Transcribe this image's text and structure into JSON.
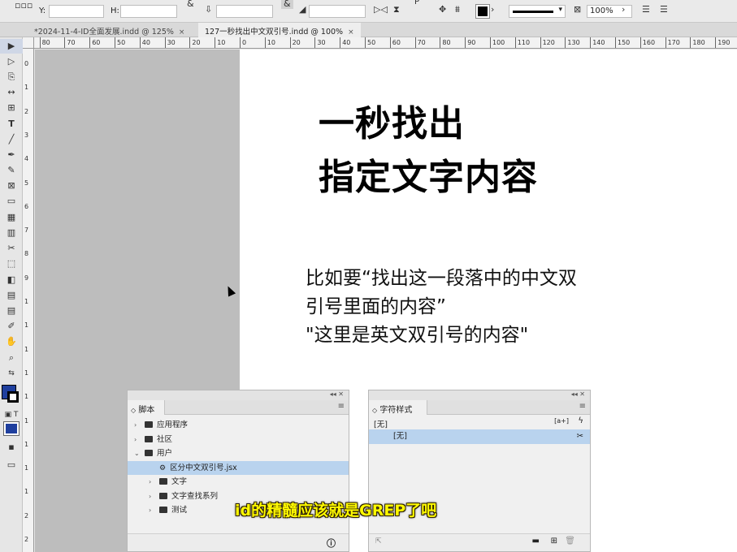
{
  "control_bar": {
    "y_label": "Y:",
    "h_label": "H:",
    "zoom_value": "100%",
    "p_label": "P"
  },
  "tabs": [
    {
      "label": "*2024-11-4-ID全面发展.indd @ 125%",
      "close": "×"
    },
    {
      "label": "127一秒找出中文双引号.indd @ 100%",
      "close": "×"
    }
  ],
  "ruler_top": {
    "labels": [
      "80",
      "70",
      "60",
      "50",
      "40",
      "30",
      "20",
      "10",
      "0",
      "10",
      "20",
      "30",
      "40",
      "50",
      "60",
      "70",
      "80",
      "90",
      "100",
      "110",
      "120",
      "130",
      "140",
      "150",
      "160",
      "170",
      "180",
      "190"
    ]
  },
  "ruler_left": {
    "labels": [
      "0",
      "1",
      "2",
      "3",
      "4",
      "5",
      "6",
      "7",
      "8",
      "9",
      "1",
      "1",
      "1",
      "1",
      "1",
      "1",
      "1",
      "1",
      "1",
      "2",
      "2"
    ]
  },
  "page": {
    "title_line1": "一秒找出",
    "title_line2": "指定文字内容",
    "body_line1": "比如要“找出这一段落中的中文双",
    "body_line2": "引号里面的内容”",
    "body_line3": "\"这里是英文双引号的内容\""
  },
  "scripts_panel": {
    "tab_label": "脚本",
    "tree": [
      {
        "label": "应用程序",
        "indent": 0,
        "type": "folder",
        "expanded": false
      },
      {
        "label": "社区",
        "indent": 0,
        "type": "folder",
        "expanded": false
      },
      {
        "label": "用户",
        "indent": 0,
        "type": "folder",
        "expanded": true
      },
      {
        "label": "区分中文双引号.jsx",
        "indent": 1,
        "type": "script",
        "selected": true
      },
      {
        "label": "文字",
        "indent": 1,
        "type": "folder",
        "expanded": false
      },
      {
        "label": "文字查找系列",
        "indent": 1,
        "type": "folder",
        "expanded": false
      },
      {
        "label": "测试",
        "indent": 1,
        "type": "folder",
        "expanded": false
      }
    ]
  },
  "char_styles_panel": {
    "tab_label": "字符样式",
    "current_style": "[无]",
    "items": [
      {
        "label": "[无]",
        "selected": true
      }
    ]
  },
  "subtitle": "id的精髓应该就是GREP了吧",
  "colors": {
    "selection": "#b9d3ee",
    "fill_swatch": "#1f3f9e",
    "subtitle": "#fffa00"
  }
}
